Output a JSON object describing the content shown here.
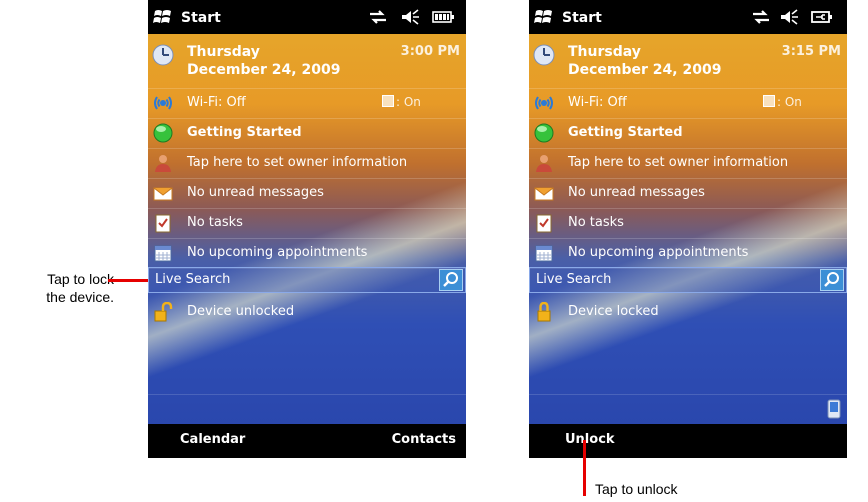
{
  "callouts": {
    "lock_line1": "Tap to lock",
    "lock_line2": "the device.",
    "unlock": "Tap to unlock"
  },
  "colors": {
    "accent_red": "#e60000",
    "search_button": "#3c8fd6"
  },
  "left_screen": {
    "title": "Start",
    "status_icons": [
      "connectivity-icon",
      "speaker-muted-icon",
      "battery-icon"
    ],
    "date_line1": "Thursday",
    "date_line2": "December 24, 2009",
    "time": "3:00 PM",
    "wifi_label": "Wi-Fi: Off",
    "wifi_toggle": ": On",
    "getting_started": "Getting Started",
    "owner_info": "Tap here to set owner information",
    "messages": "No unread messages",
    "tasks": "No tasks",
    "appointments": "No upcoming appointments",
    "search_label": "Live Search",
    "lock_status": "Device unlocked",
    "softkey_left": "Calendar",
    "softkey_right": "Contacts"
  },
  "right_screen": {
    "title": "Start",
    "status_icons": [
      "connectivity-icon",
      "speaker-muted-icon",
      "battery-charging-icon"
    ],
    "date_line1": "Thursday",
    "date_line2": "December 24, 2009",
    "time": "3:15 PM",
    "wifi_label": "Wi-Fi: Off",
    "wifi_toggle": ": On",
    "getting_started": "Getting Started",
    "owner_info": "Tap here to set owner information",
    "messages": "No unread messages",
    "tasks": "No tasks",
    "appointments": "No upcoming appointments",
    "search_label": "Live Search",
    "lock_status": "Device locked",
    "softkey_left": "Unlock"
  }
}
